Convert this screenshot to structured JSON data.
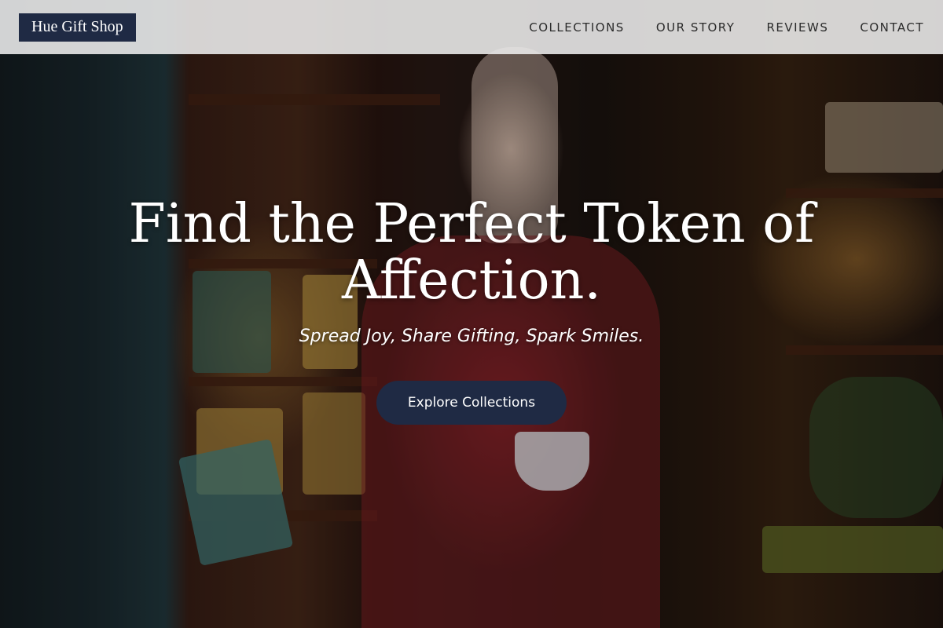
{
  "brand": {
    "name": "Hue Gift Shop"
  },
  "nav": {
    "items": [
      {
        "label": "COLLECTIONS"
      },
      {
        "label": "OUR STORY"
      },
      {
        "label": "REVIEWS"
      },
      {
        "label": "CONTACT"
      }
    ]
  },
  "hero": {
    "headline": "Find the Perfect Token of Affection.",
    "tagline": "Spread Joy, Share Gifting, Spark Smiles.",
    "cta_label": "Explore Collections"
  },
  "colors": {
    "brand_bg": "#1f2a44",
    "cta_bg": "#1f2a44",
    "nav_bg": "#eeeeee",
    "text_light": "#ffffff"
  }
}
